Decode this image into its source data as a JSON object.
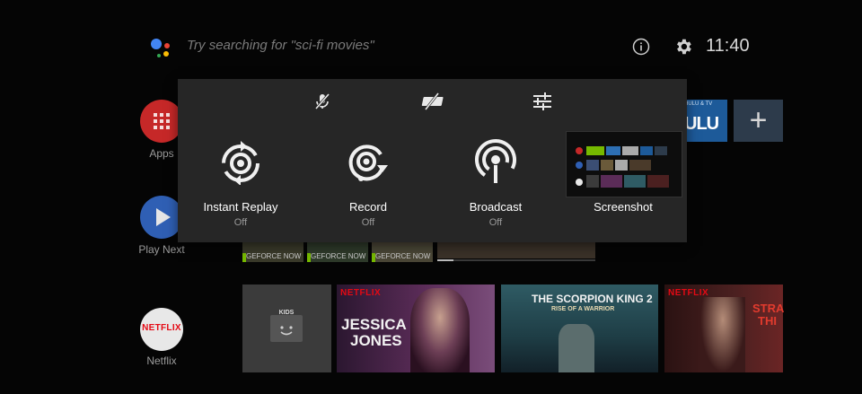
{
  "header": {
    "search_hint": "Try searching for \"sci-fi movies\"",
    "clock": "11:40"
  },
  "rail": {
    "apps_label": "Apps",
    "play_next_label": "Play Next",
    "netflix_label": "Netflix",
    "netflix_logo": "NETFLIX"
  },
  "row1": {
    "hulu_small": "HULU & TV",
    "hulu_text": "ULU",
    "add_symbol": "+"
  },
  "row2": {
    "geforce_label": "GEFORCE NOW",
    "progress_fraction": 0.1
  },
  "row3": {
    "kids_label": "KIDS",
    "netflix_badge": "NETFLIX",
    "jessica_title_1": "JESSICA",
    "jessica_title_2": "JONES",
    "scorpion_title": "THE SCORPION KING 2",
    "scorpion_subtitle": "RISE OF A WARRIOR",
    "stranger_title_1": "STRA",
    "stranger_title_2": "THI"
  },
  "overlay": {
    "items": [
      {
        "label": "Instant Replay",
        "state": "Off"
      },
      {
        "label": "Record",
        "state": "Off"
      },
      {
        "label": "Broadcast",
        "state": "Off"
      },
      {
        "label": "Screenshot"
      }
    ],
    "top_icons": [
      "mic-off-icon",
      "camera-off-icon",
      "settings-sliders-icon"
    ]
  },
  "colors": {
    "apps_red": "#c62828",
    "play_blue": "#2f5fb4",
    "netflix_red": "#e50914"
  }
}
